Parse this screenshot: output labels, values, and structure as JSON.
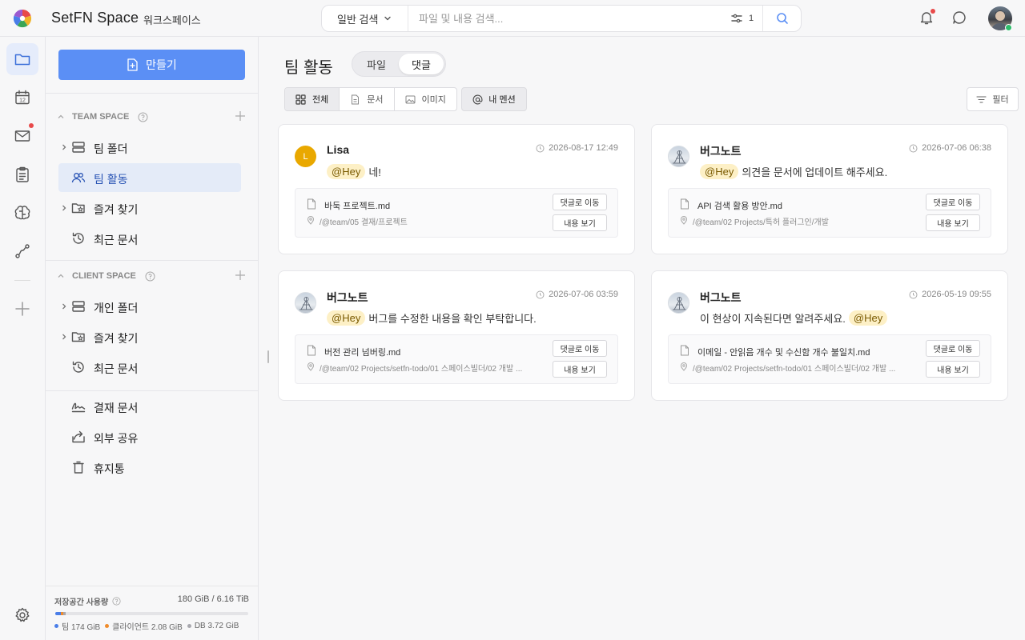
{
  "app": {
    "brand": "SetFN Space",
    "workspace": "워크스페이스",
    "accent": "#5b8ff5"
  },
  "search": {
    "mode_label": "일반 검색",
    "placeholder": "파일 및 내용 검색...",
    "filter_count": "1"
  },
  "rail": {
    "items": [
      "folder-icon",
      "calendar-icon",
      "mail-icon",
      "clipboard-icon",
      "brain-icon",
      "route-icon",
      "plus-icon",
      "settings-icon"
    ],
    "calendar_day": "12"
  },
  "sidebar": {
    "create_label": "만들기",
    "team_space": {
      "title": "TEAM SPACE",
      "items": [
        {
          "label": "팀 폴더",
          "icon": "server-icon"
        },
        {
          "label": "팀 활동",
          "icon": "users-icon",
          "active": true
        },
        {
          "label": "즐겨 찾기",
          "icon": "star-folder-icon"
        },
        {
          "label": "최근 문서",
          "icon": "history-icon"
        }
      ]
    },
    "client_space": {
      "title": "CLIENT SPACE",
      "items": [
        {
          "label": "개인 폴더",
          "icon": "server-icon"
        },
        {
          "label": "즐겨 찾기",
          "icon": "star-folder-icon"
        },
        {
          "label": "최근 문서",
          "icon": "history-icon"
        }
      ]
    },
    "extra": [
      {
        "label": "결재 문서",
        "icon": "signature-icon"
      },
      {
        "label": "외부 공유",
        "icon": "share-icon"
      },
      {
        "label": "휴지통",
        "icon": "trash-icon"
      }
    ],
    "storage": {
      "title": "저장공간 사용량",
      "total": "180 GiB / 6.16 TiB",
      "segments": [
        {
          "label": "팀 174 GiB",
          "color": "#4a7ee8",
          "fraction": 0.028
        },
        {
          "label": "클라이언트 2.08 GiB",
          "color": "#f08c2c",
          "fraction": 0.012
        },
        {
          "label": "DB 3.72 GiB",
          "color": "#a8a8ae",
          "fraction": 0.012
        }
      ]
    }
  },
  "main": {
    "title": "팀 활동",
    "segment": [
      {
        "label": "파일",
        "active": false
      },
      {
        "label": "댓글",
        "active": true
      }
    ],
    "chips": [
      {
        "label": "전체",
        "icon": "grid-icon",
        "active": true
      },
      {
        "label": "문서",
        "icon": "document-icon",
        "active": false
      },
      {
        "label": "이미지",
        "icon": "image-icon",
        "active": false
      }
    ],
    "mention_filter": "내 멘션",
    "filter_label": "필터",
    "cards": [
      {
        "author": "Lisa",
        "avatar_letter": "L",
        "time": "2026-08-17 12:49",
        "mention": "@Hey",
        "message": "네!",
        "mention_first": true,
        "file_name": "바둑 프로젝트.md",
        "file_path": "/@team/05 결재/프로젝트",
        "btn_comment": "댓글로 이동",
        "btn_view": "내용 보기"
      },
      {
        "author": "버그노트",
        "avatar_letter": "",
        "time": "2026-07-06 06:38",
        "mention": "@Hey",
        "message": "의견을 문서에 업데이트 해주세요.",
        "mention_first": true,
        "file_name": "API 검색 활용 방안.md",
        "file_path": "/@team/02 Projects/특허 플러그인/개발",
        "btn_comment": "댓글로 이동",
        "btn_view": "내용 보기"
      },
      {
        "author": "버그노트",
        "avatar_letter": "",
        "time": "2026-07-06 03:59",
        "mention": "@Hey",
        "message": "버그를 수정한 내용을 확인 부탁합니다.",
        "mention_first": true,
        "file_name": "버전 관리 넘버링.md",
        "file_path": "/@team/02 Projects/setfn-todo/01 스페이스빌더/02 개발 ...",
        "btn_comment": "댓글로 이동",
        "btn_view": "내용 보기"
      },
      {
        "author": "버그노트",
        "avatar_letter": "",
        "time": "2026-05-19 09:55",
        "mention": "@Hey",
        "message": "이 현상이 지속된다면 알려주세요.",
        "mention_first": false,
        "file_name": "이메일 - 안읽음 개수 및 수신함 개수 불일치.md",
        "file_path": "/@team/02 Projects/setfn-todo/01 스페이스빌더/02 개발 ...",
        "btn_comment": "댓글로 이동",
        "btn_view": "내용 보기"
      }
    ]
  }
}
